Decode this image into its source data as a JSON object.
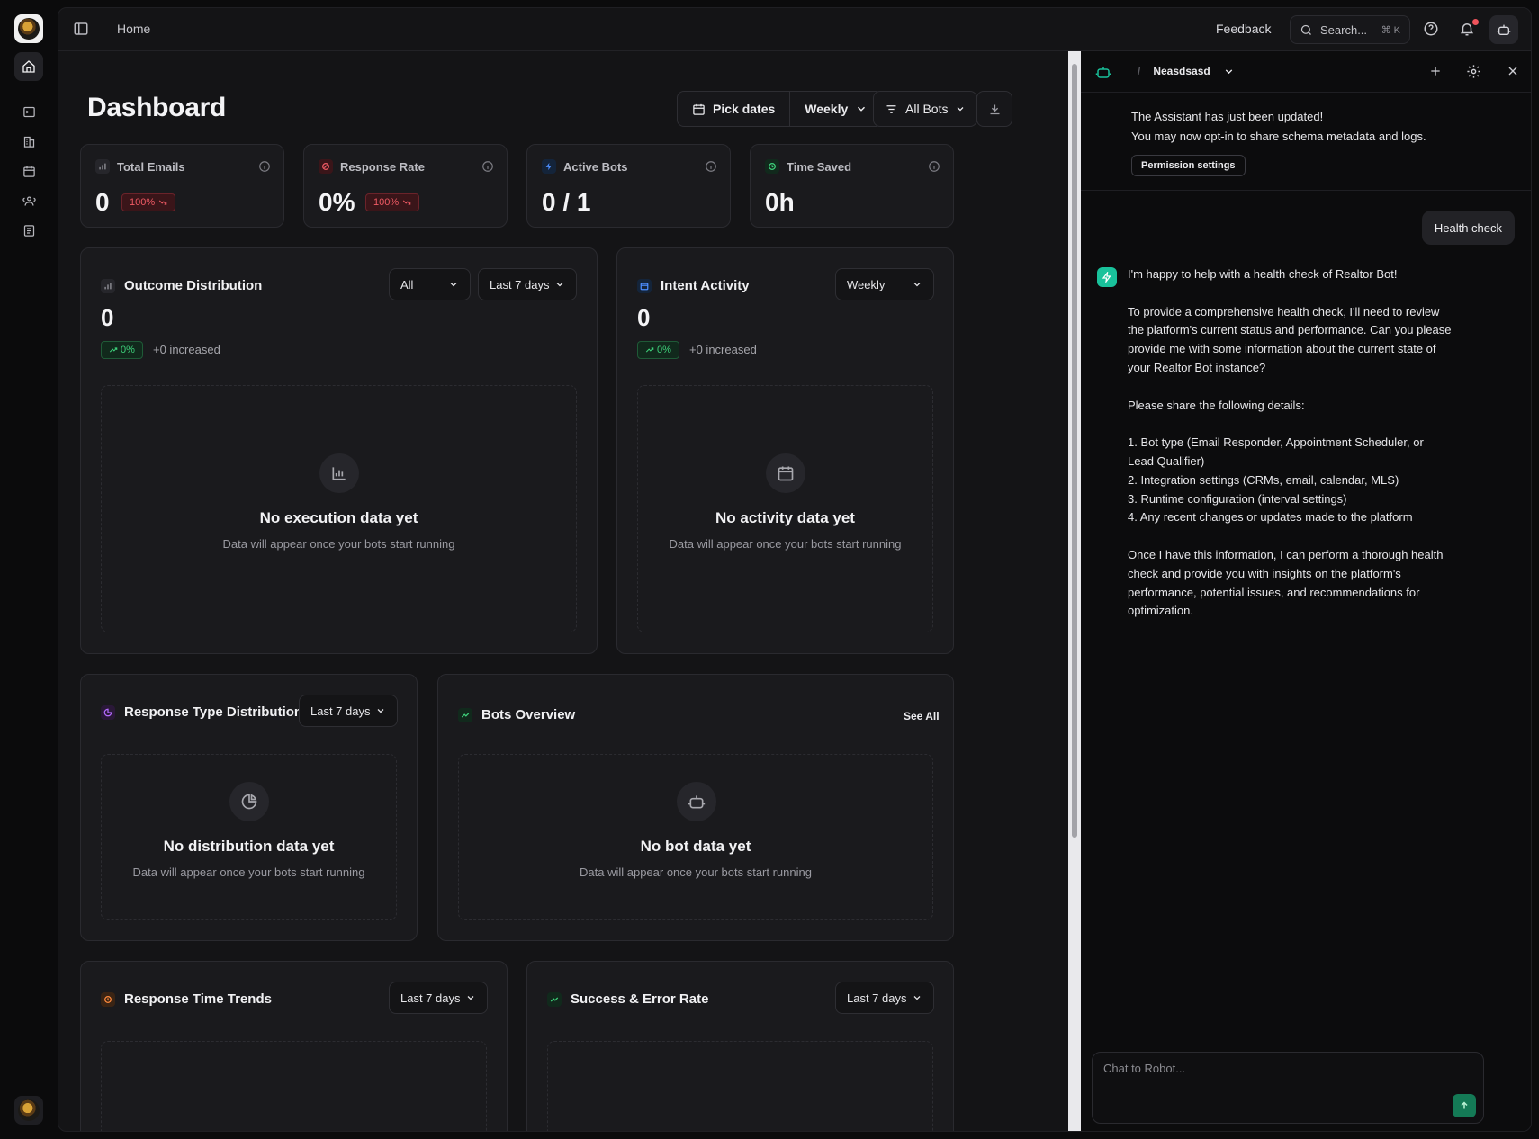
{
  "header": {
    "breadcrumb": "Home",
    "feedback": "Feedback",
    "search_placeholder": "Search...",
    "search_shortcut": "⌘ K"
  },
  "dashboard": {
    "title": "Dashboard",
    "pick_dates": "Pick dates",
    "period": "Weekly",
    "bots_filter": "All Bots",
    "stats": [
      {
        "label": "Total Emails",
        "value": "0",
        "badge": "100%"
      },
      {
        "label": "Response Rate",
        "value": "0%",
        "badge": "100%"
      },
      {
        "label": "Active Bots",
        "value": "0 / 1"
      },
      {
        "label": "Time Saved",
        "value": "0h"
      }
    ],
    "outcome": {
      "title": "Outcome Distribution",
      "filter": "All",
      "range": "Last 7 days",
      "value": "0",
      "badge": "0%",
      "change": "+0 increased",
      "empty_title": "No execution data yet",
      "empty_sub": "Data will appear once your bots start running"
    },
    "intent": {
      "title": "Intent Activity",
      "range": "Weekly",
      "value": "0",
      "badge": "0%",
      "change": "+0 increased",
      "empty_title": "No activity data yet",
      "empty_sub": "Data will appear once your bots start running"
    },
    "response_type": {
      "title": "Response Type Distribution",
      "range": "Last 7 days",
      "empty_title": "No distribution data yet",
      "empty_sub": "Data will appear once your bots start running"
    },
    "bots_overview": {
      "title": "Bots Overview",
      "see_all": "See All",
      "empty_title": "No bot data yet",
      "empty_sub": "Data will appear once your bots start running"
    },
    "response_time": {
      "title": "Response Time Trends",
      "range": "Last 7 days"
    },
    "success_error": {
      "title": "Success & Error Rate",
      "range": "Last 7 days"
    }
  },
  "assistant": {
    "bot_name": "Neasdsasd",
    "notice_line1": "The Assistant has just been updated!",
    "notice_line2": "You may now opt-in to share schema metadata and logs.",
    "permission_button": "Permission settings",
    "user_message": "Health check",
    "bot_messages": [
      "I'm happy to help with a health check of Realtor Bot!",
      "To provide a comprehensive health check, I'll need to review the platform's current status and performance. Can you please provide me with some information about the current state of your Realtor Bot instance?",
      "Please share the following details:",
      "1. Bot type (Email Responder, Appointment Scheduler, or Lead Qualifier)",
      "2. Integration settings (CRMs, email, calendar, MLS)",
      "3. Runtime configuration (interval settings)",
      "4. Any recent changes or updates made to the platform",
      "Once I have this information, I can perform a thorough health check and provide you with insights on the platform's performance, potential issues, and recommendations for optimization."
    ],
    "chat_placeholder": "Chat to Robot..."
  },
  "colors": {
    "accent_green": "#19c29b",
    "negative_red": "#f05a64",
    "positive_green": "#3ed07a",
    "notification_dot": "#f0545c"
  }
}
